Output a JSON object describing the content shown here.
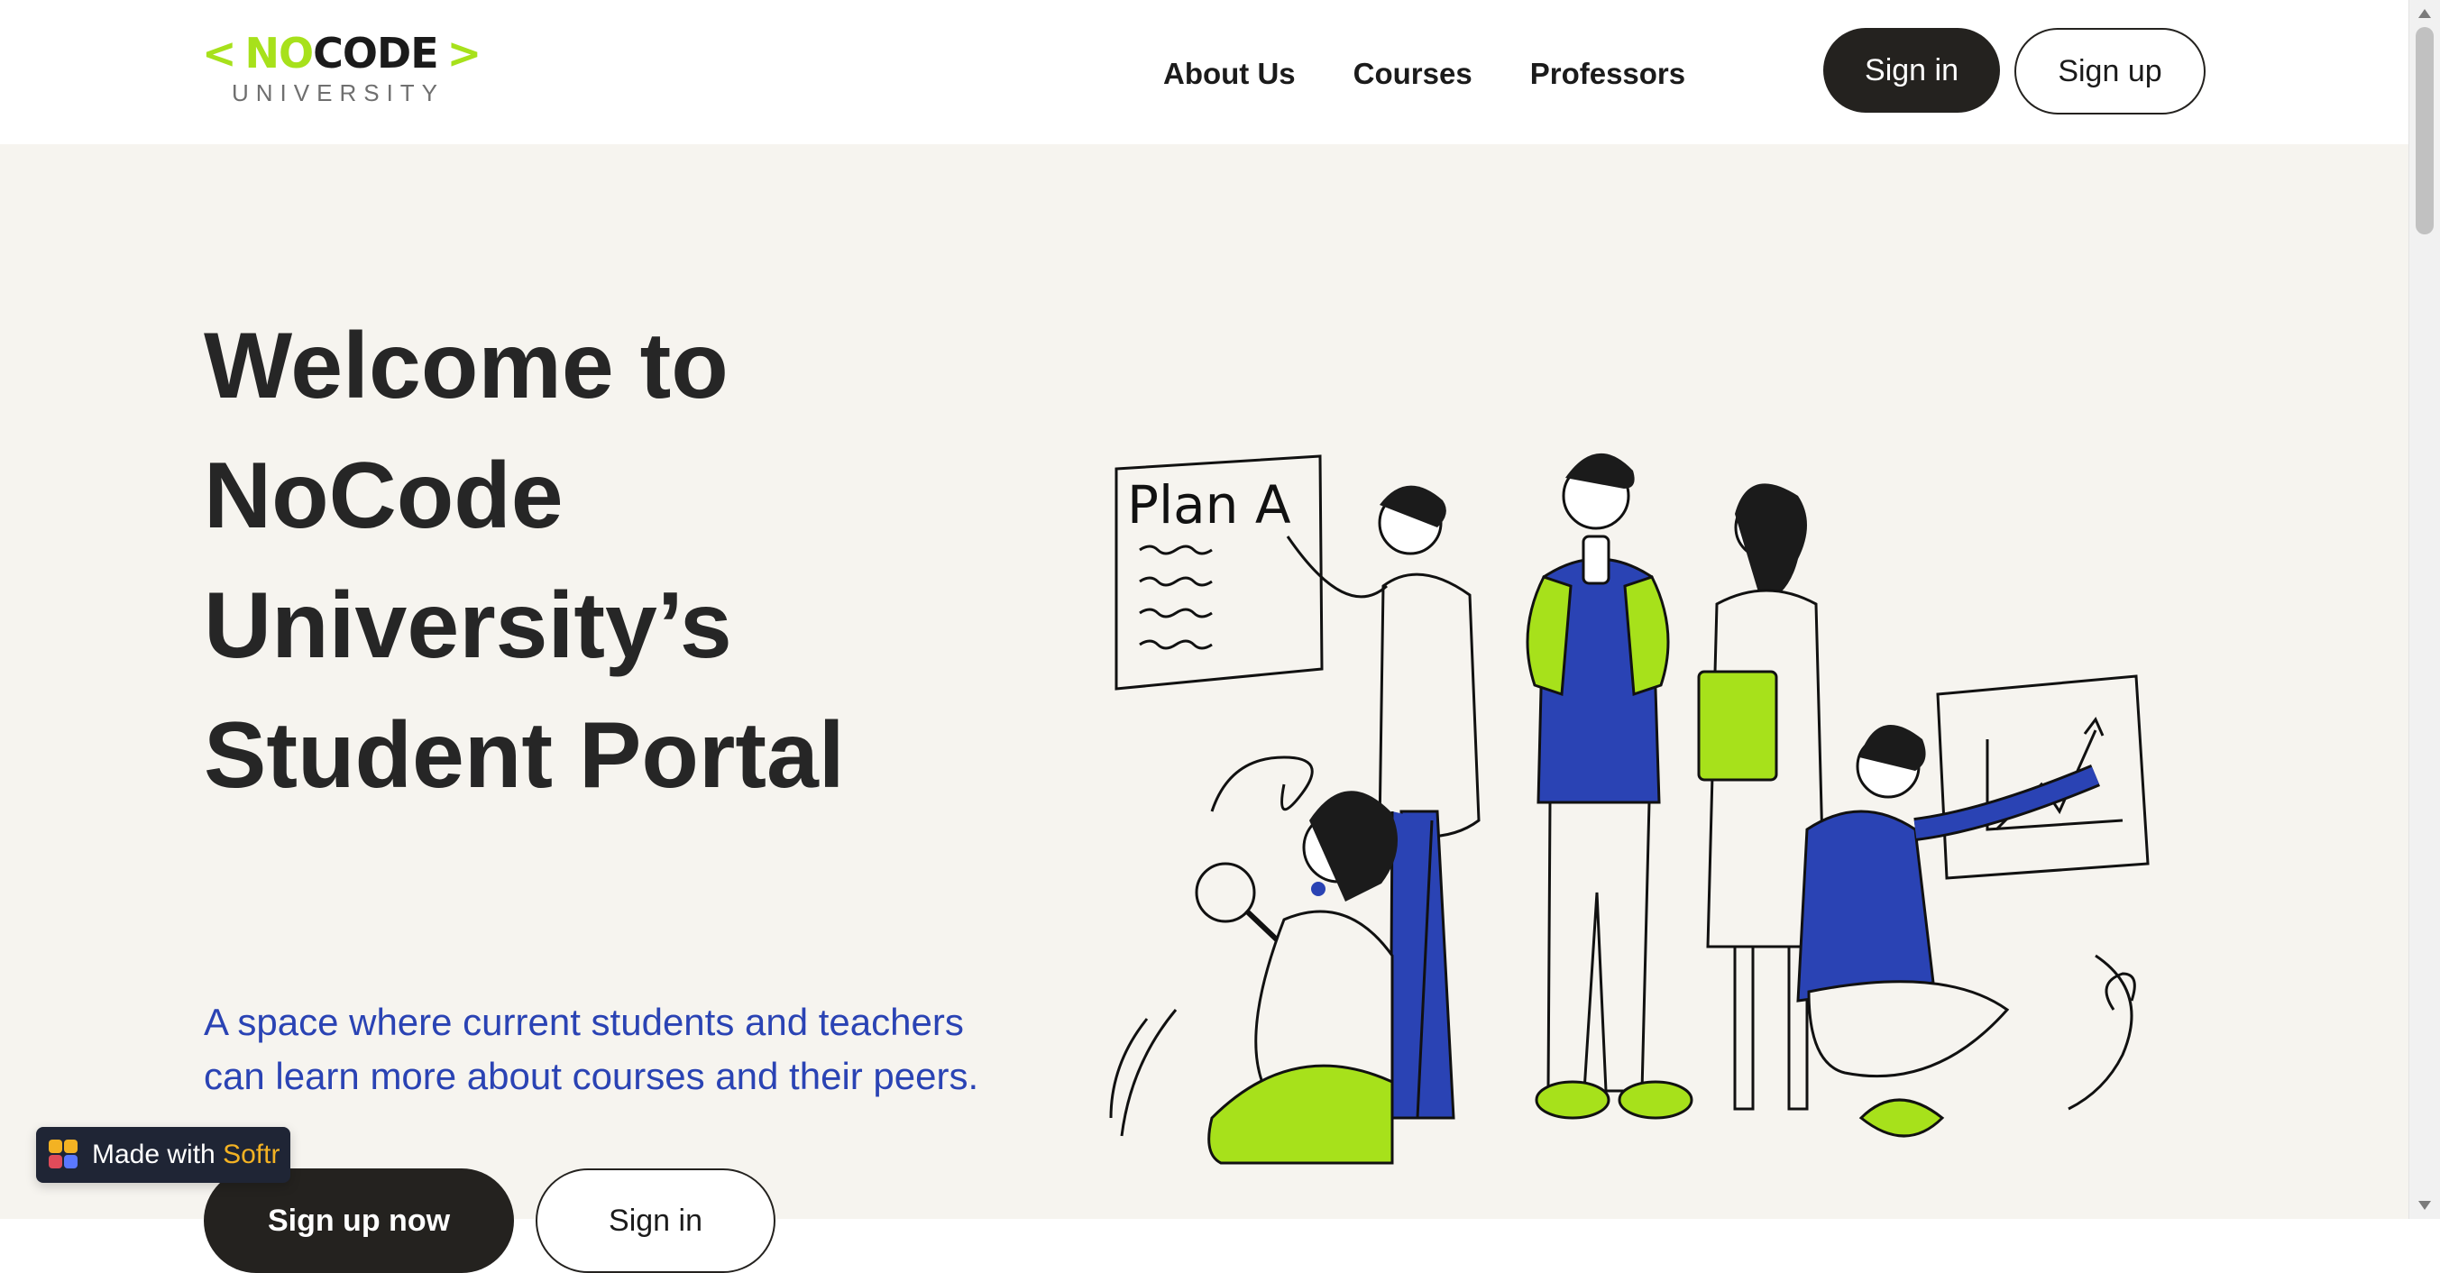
{
  "header": {
    "logo": {
      "left_bracket": "<",
      "no": "NO",
      "code": "CODE",
      "right_bracket": ">",
      "subtitle": "UNIVERSITY"
    },
    "nav": [
      {
        "label": "About Us"
      },
      {
        "label": "Courses"
      },
      {
        "label": "Professors"
      }
    ],
    "signin_label": "Sign in",
    "signup_label": "Sign up"
  },
  "hero": {
    "title": "Welcome to\nNoCode\nUniversity’s\nStudent Portal",
    "subtitle": "A space where current students and teachers can learn more about courses and their peers.",
    "primary_cta": "Sign up now",
    "secondary_cta": "Sign in",
    "illustration": {
      "board_text": "Plan A",
      "icon": "students-collaboration-illustration"
    }
  },
  "badge": {
    "prefix": "Made with",
    "brand": "Softr"
  },
  "colors": {
    "accent": "#a7e11b",
    "blue": "#2a43b4",
    "dark": "#24221f",
    "hero_bg": "#f6f4ef",
    "softr_yellow": "#f3b223"
  }
}
